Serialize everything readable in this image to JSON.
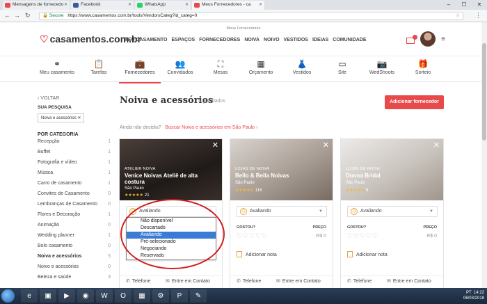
{
  "browser": {
    "tabs": [
      {
        "label": "Mensagens de fornecedo",
        "color": "#e8494a"
      },
      {
        "label": "Facebook",
        "color": "#3b5998"
      },
      {
        "label": "WhatsApp",
        "color": "#25d366"
      },
      {
        "label": "Meus Fornecedores - ca",
        "color": "#e8494a"
      }
    ],
    "secure_label": "Secure",
    "url": "https://www.casamentos.com.br/tools/VendorsCateg?id_categ=0"
  },
  "site": {
    "top_strip": "Meus Fornecedores",
    "logo": "casamentos.com.br",
    "main_nav": [
      "MEU CASAMENTO",
      "ESPAÇOS",
      "FORNECEDORES",
      "NOIVA",
      "NOIVO",
      "VESTIDOS",
      "IDEIAS",
      "COMUNIDADE"
    ],
    "icon_nav": [
      {
        "label": "Meu casamento",
        "icon": "rings-icon"
      },
      {
        "label": "Tarefas",
        "icon": "clipboard-icon"
      },
      {
        "label": "Fornecedores",
        "icon": "briefcase-icon"
      },
      {
        "label": "Convidados",
        "icon": "guests-icon"
      },
      {
        "label": "Mesas",
        "icon": "tables-icon"
      },
      {
        "label": "Orçamento",
        "icon": "calculator-icon"
      },
      {
        "label": "Vestidos",
        "icon": "dress-icon"
      },
      {
        "label": "Site",
        "icon": "website-icon"
      },
      {
        "label": "WedShoots",
        "icon": "camera-icon"
      },
      {
        "label": "Sorteio",
        "icon": "gift-icon"
      }
    ]
  },
  "sidebar": {
    "back": "VOLTAR",
    "search_title": "SUA PESQUISA",
    "chip": "Noiva e acessórios",
    "category_title": "POR CATEGORIA",
    "categories": [
      {
        "label": "Recepção",
        "count": "1"
      },
      {
        "label": "Buffet",
        "count": "1"
      },
      {
        "label": "Fotografia e vídeo",
        "count": "1"
      },
      {
        "label": "Música",
        "count": "1"
      },
      {
        "label": "Carro de casamento",
        "count": "1"
      },
      {
        "label": "Convites de Casamento",
        "count": "0"
      },
      {
        "label": "Lembranças de Casamento",
        "count": "0"
      },
      {
        "label": "Flores e Decoração",
        "count": "1"
      },
      {
        "label": "Animação",
        "count": "0"
      },
      {
        "label": "Wedding planner",
        "count": "1"
      },
      {
        "label": "Bolo casamento",
        "count": "0"
      },
      {
        "label": "Noiva e acessórios",
        "count": "5"
      },
      {
        "label": "Noivo e acessórios",
        "count": "0"
      },
      {
        "label": "Beleza e saúde",
        "count": "3"
      }
    ]
  },
  "main": {
    "title": "Noiva e acessórios",
    "saved": "5 guardados",
    "add_button": "Adicionar fornecedor",
    "undecided": "Ainda não decidiu?",
    "undecided_link": "Buscar Noiva e acessórios em São Paulo",
    "labels": {
      "gostou": "GOSTOU?",
      "preco": "PREÇO",
      "price_value": "R$ 0",
      "note": "Adicionar nota",
      "phone": "Telefone",
      "contact": "Entre em Contato"
    },
    "cards": [
      {
        "category": "ATELIER NOIVA",
        "name": "Venice Noivas Ateliê de alta costura",
        "location": "São Paulo",
        "stars": "★★★★★",
        "reviews": "21",
        "status": "Avaliando"
      },
      {
        "category": "LOJAS DE NOIVA",
        "name": "Bello & Bella Noivas",
        "location": "São Paulo",
        "stars": "★★★★★",
        "reviews": "116",
        "status": "Avaliando"
      },
      {
        "category": "LOJAS DE NOIVA",
        "name": "Donna Bridal",
        "location": "São Paulo",
        "stars": "★★★★★",
        "reviews": "8",
        "status": "Avaliando"
      }
    ],
    "dropdown_options": [
      "Não disponível",
      "Descartado",
      "Avaliando",
      "Pré-selecionado",
      "Negociando",
      "Reservado"
    ],
    "dropdown_selected": "Avaliando"
  },
  "taskbar": {
    "lang": "PT",
    "time": "14:22",
    "date": "06/03/2018"
  },
  "colors": {
    "accent": "#e8494a",
    "selection": "#3a7bd5",
    "annotation": "#d21c1c"
  }
}
